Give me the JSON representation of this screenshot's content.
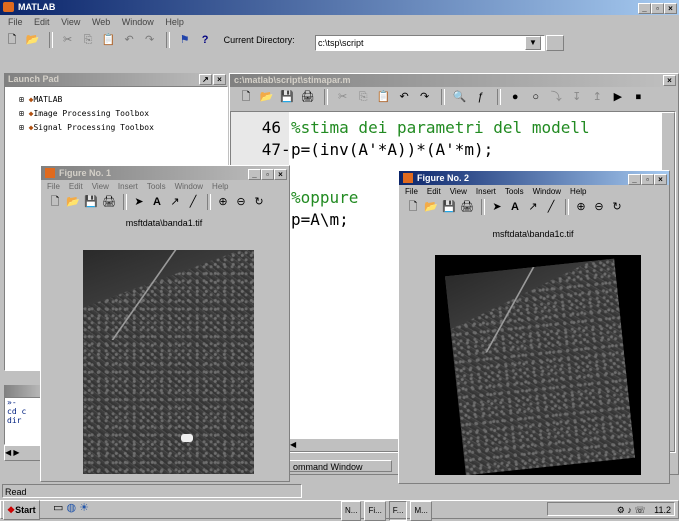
{
  "app": {
    "title": "MATLAB",
    "menu": [
      "File",
      "Edit",
      "View",
      "Web",
      "Window",
      "Help"
    ]
  },
  "toolbar": {
    "current_dir_label": "Current Directory:",
    "current_dir_value": "c:\\tsp\\script"
  },
  "launch_pad": {
    "title": "Launch Pad",
    "items": [
      "MATLAB",
      "Image Processing Toolbox",
      "Signal Processing Toolbox"
    ]
  },
  "editor": {
    "title": "c:\\matlab\\script\\stimapar.m",
    "lines": [
      {
        "num": "46",
        "text": "%stima dei parametri del modell",
        "type": "comment"
      },
      {
        "num": "47",
        "text": "p=(inv(A'*A))*(A'*m);",
        "type": "code"
      },
      {
        "num": "",
        "text": "",
        "type": "code"
      },
      {
        "num": "",
        "text": "%oppure",
        "type": "comment"
      },
      {
        "num": "",
        "text": "p=A\\m;",
        "type": "code"
      }
    ]
  },
  "command_window": {
    "title": "Command Window",
    "tab_label": "ommand Window",
    "lines": [
      "»-",
      "cd c",
      "dir"
    ]
  },
  "figure1": {
    "title": "Figure No. 1",
    "menu": [
      "File",
      "Edit",
      "View",
      "Insert",
      "Tools",
      "Window",
      "Help"
    ],
    "image_title": "msftdata\\banda1.tif"
  },
  "figure2": {
    "title": "Figure No. 2",
    "menu": [
      "File",
      "Edit",
      "View",
      "Insert",
      "Tools",
      "Window",
      "Help"
    ],
    "image_title": "msftdata\\banda1c.tif"
  },
  "status": {
    "text": "Read"
  },
  "taskbar": {
    "start_label": "Start",
    "tasks": [
      "N...",
      "Fi...",
      "F...",
      "M..."
    ],
    "clock": "11.2"
  },
  "colors": {
    "comment": "#228b22",
    "code": "#000000",
    "title_active": "#0a246a"
  }
}
